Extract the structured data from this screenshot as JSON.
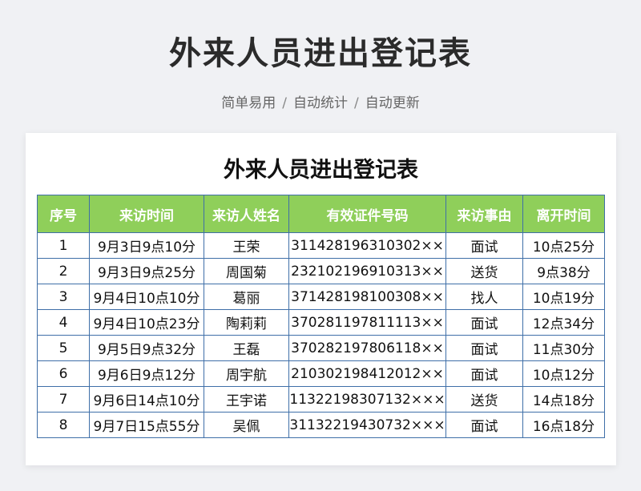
{
  "header": {
    "title": "外来人员进出登记表",
    "subtitle_items": [
      "简单易用",
      "自动统计",
      "自动更新"
    ],
    "separator": "/"
  },
  "document": {
    "title": "外来人员进出登记表",
    "columns": [
      "序号",
      "来访时间",
      "来访人姓名",
      "有效证件号码",
      "来访事由",
      "离开时间"
    ],
    "rows": [
      [
        "1",
        "9月3日9点10分",
        "王荣",
        "311428196310302××",
        "面试",
        "10点25分"
      ],
      [
        "2",
        "9月3日9点25分",
        "周国菊",
        "232102196910313××",
        "送货",
        "9点38分"
      ],
      [
        "3",
        "9月4日10点10分",
        "葛丽",
        "371428198100308××",
        "找人",
        "10点19分"
      ],
      [
        "4",
        "9月4日10点23分",
        "陶莉莉",
        "370281197811113××",
        "面试",
        "12点34分"
      ],
      [
        "5",
        "9月5日9点32分",
        "王磊",
        "370282197806118××",
        "面试",
        "11点30分"
      ],
      [
        "6",
        "9月6日9点12分",
        "周宇航",
        "210302198412012××",
        "面试",
        "10点12分"
      ],
      [
        "7",
        "9月6日14点10分",
        "王宇诺",
        "11322198307132×××",
        "送货",
        "14点18分"
      ],
      [
        "8",
        "9月7日15点55分",
        "吴佩",
        "31132219430732×××",
        "面试",
        "16点18分"
      ]
    ],
    "colors": {
      "header_bg": "#8fcf5a",
      "border": "#3f6fa8"
    }
  }
}
